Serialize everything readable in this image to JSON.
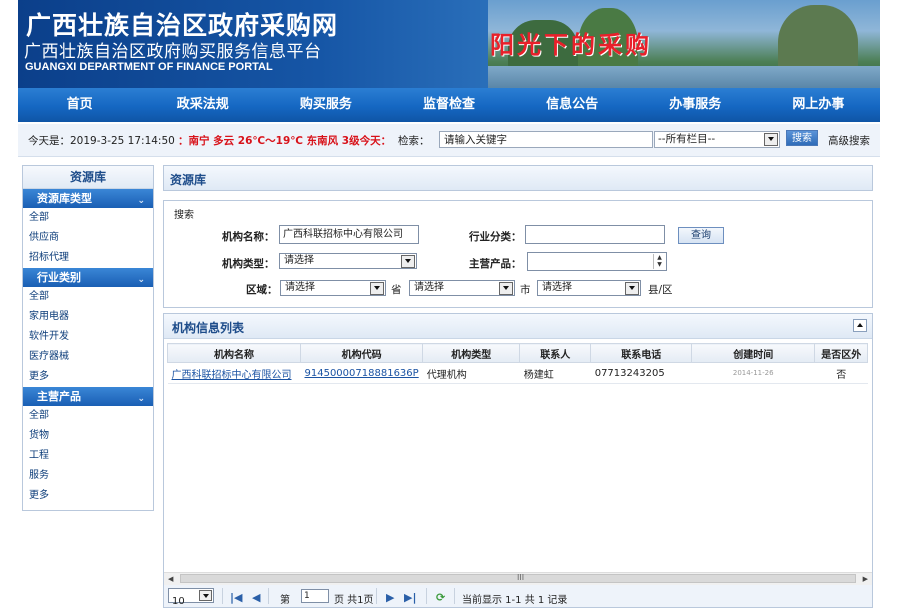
{
  "banner": {
    "title_main": "广西壮族自治区政府采购网",
    "title_sub": "广西壮族自治区政府购买服务信息平台",
    "title_en": "GUANGXI DEPARTMENT OF FINANCE PORTAL",
    "slogan": "阳光下的采购"
  },
  "nav": [
    "首页",
    "政采法规",
    "购买服务",
    "监督检查",
    "信息公告",
    "办事服务",
    "网上办事"
  ],
  "infobar": {
    "date": "今天是：2019-3-25 17:14:50",
    "weather": "：南宁 多云 26℃～19℃ 东南风 3级今天：",
    "search_label": "检索：",
    "keyword_value": "请输入关键字",
    "column_select": "--所有栏目--",
    "search_button": "搜索",
    "advanced_search": "高级搜索"
  },
  "sidebar": {
    "header": "资源库",
    "sections": [
      {
        "title": "资源库类型",
        "items": [
          "全部",
          "供应商",
          "招标代理"
        ]
      },
      {
        "title": "行业类别",
        "items": [
          "全部",
          "家用电器",
          "软件开发",
          "医疗器械",
          "更多"
        ]
      },
      {
        "title": "主营产品",
        "items": [
          "全部",
          "货物",
          "工程",
          "服务",
          "更多"
        ]
      }
    ]
  },
  "main": {
    "title": "资源库",
    "search": {
      "legend": "搜索",
      "org_name_label": "机构名称：",
      "org_name_value": "广西科联招标中心有限公司",
      "industry_label": "行业分类：",
      "industry_value": "",
      "query_button": "查询",
      "org_type_label": "机构类型：",
      "org_type_value": "请选择",
      "main_product_label": "主营产品：",
      "main_product_value": "",
      "region_label": "区域：",
      "province_value": "请选择",
      "province_unit": "省",
      "city_value": "请选择",
      "city_unit": "市",
      "county_value": "请选择",
      "county_unit": "县/区"
    },
    "list": {
      "title": "机构信息列表",
      "columns": [
        "机构名称",
        "机构代码",
        "机构类型",
        "联系人",
        "联系电话",
        "创建时间",
        "是否区外"
      ],
      "rows": [
        [
          "广西科联招标中心有限公司",
          "91450000718881636P",
          "代理机构",
          "杨建虹",
          "07713243205",
          "2014-11-26",
          "否"
        ]
      ]
    },
    "scroll_mid": "III",
    "pager": {
      "page_size": "10",
      "page_label": "第",
      "page_value": "1",
      "page_total": "页 共1页",
      "summary": "当前显示 1-1 共 1 记录"
    }
  }
}
